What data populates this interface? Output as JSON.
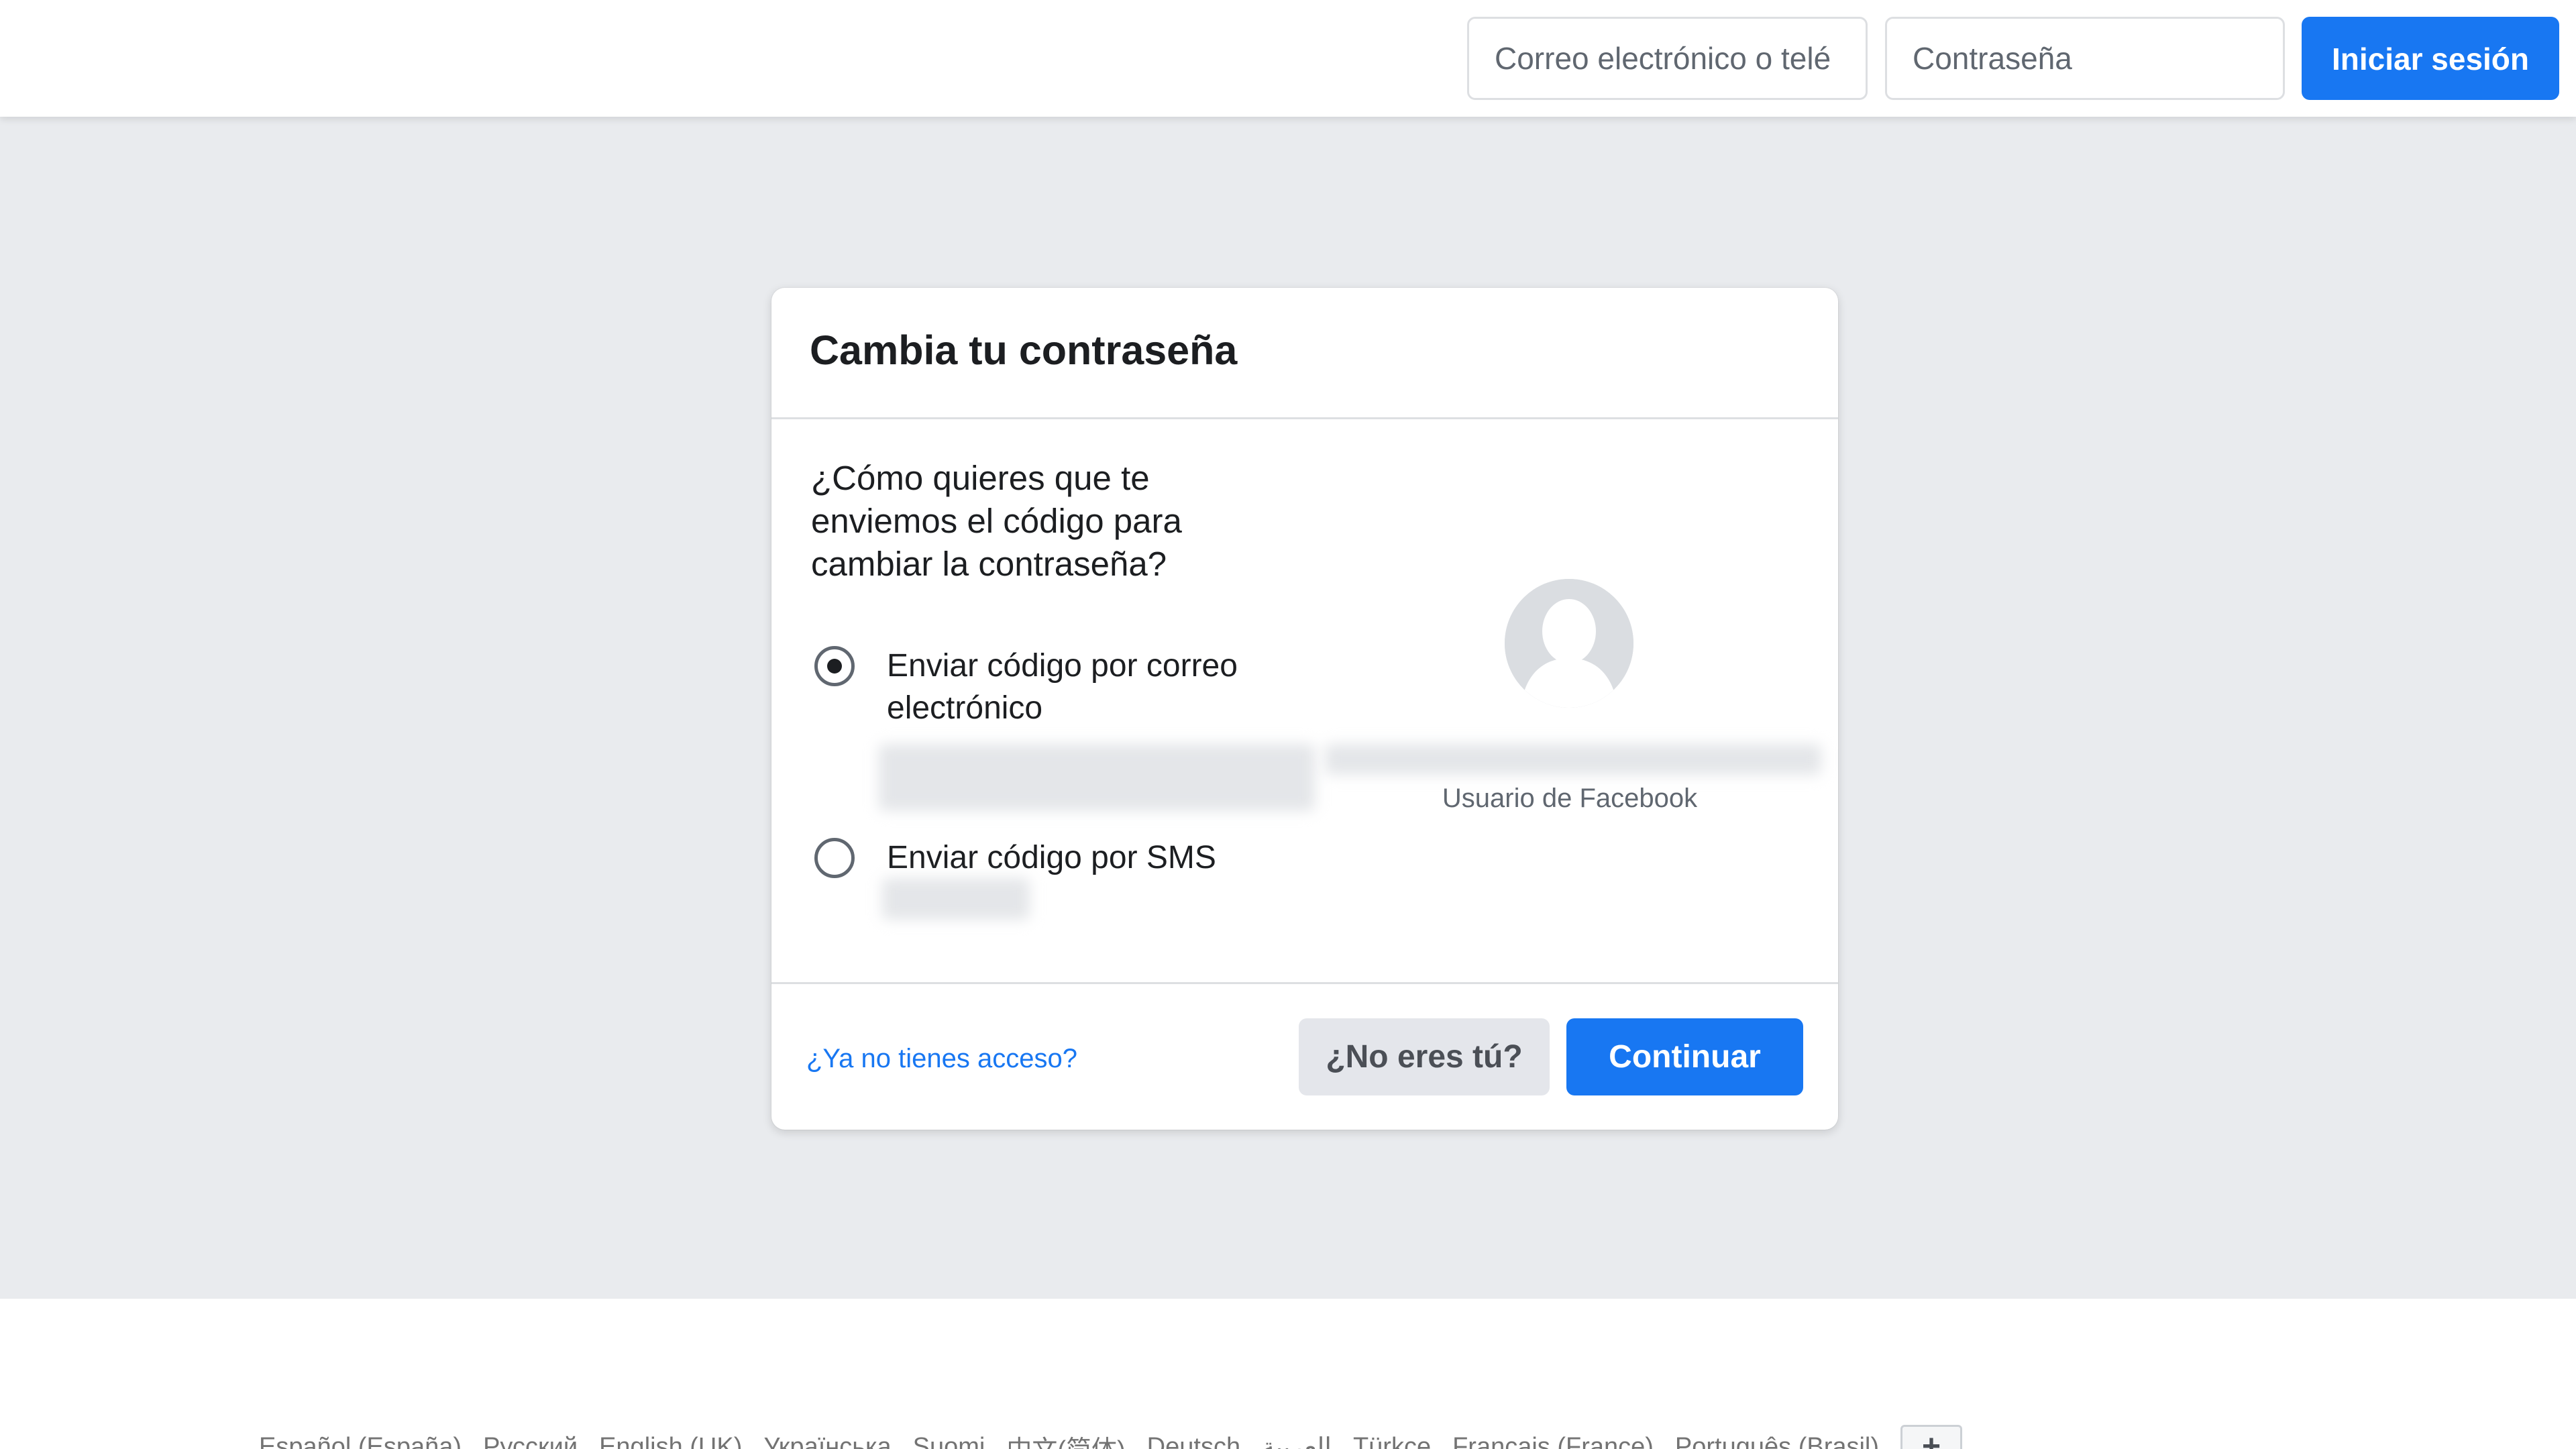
{
  "header": {
    "email_placeholder": "Correo electrónico o telé",
    "password_placeholder": "Contraseña",
    "login_label": "Iniciar sesión"
  },
  "card": {
    "title": "Cambia tu contraseña",
    "question": "¿Cómo quieres que te enviemos el código para cambiar la contraseña?",
    "options": [
      {
        "label": "Enviar código por correo electrónico",
        "checked": true
      },
      {
        "label": "Enviar código por SMS",
        "checked": false
      }
    ],
    "user_caption": "Usuario de Facebook",
    "no_access_link": "¿Ya no tienes acceso?",
    "not_you_label": "¿No eres tú?",
    "continue_label": "Continuar"
  },
  "footer": {
    "languages": [
      "Español (España)",
      "Русский",
      "English (UK)",
      "Українська",
      "Suomi",
      "中文(简体)",
      "Deutsch",
      "العربية",
      "Türkçe",
      "Français (France)",
      "Português (Brasil)"
    ],
    "more_label": "+"
  },
  "colors": {
    "accent": "#1877f2",
    "page_background": "#e9ebee",
    "divider": "#dddfe2",
    "secondary_button": "#e4e6eb"
  }
}
